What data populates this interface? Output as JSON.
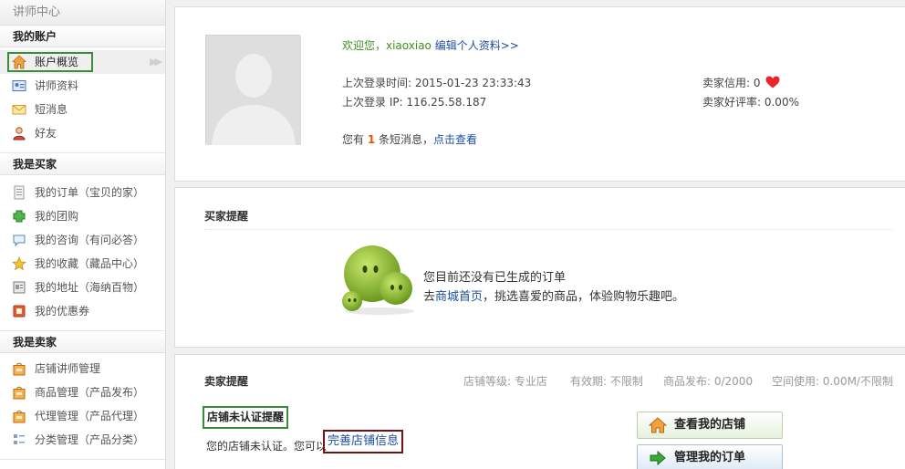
{
  "sidebar": {
    "title": "讲师中心",
    "sections": [
      {
        "title": "我的账户",
        "items": [
          {
            "label": "账户概览",
            "icon": "home-icon",
            "active": true
          },
          {
            "label": "讲师资料",
            "icon": "profile-card-icon"
          },
          {
            "label": "短消息",
            "icon": "envelope-icon"
          },
          {
            "label": "好友",
            "icon": "friend-icon"
          }
        ]
      },
      {
        "title": "我是买家",
        "items": [
          {
            "label": "我的订单（宝贝的家）",
            "icon": "order-icon"
          },
          {
            "label": "我的团购",
            "icon": "puzzle-icon"
          },
          {
            "label": "我的咨询（有问必答）",
            "icon": "speech-bubble-icon"
          },
          {
            "label": "我的收藏（藏品中心）",
            "icon": "star-icon"
          },
          {
            "label": "我的地址（海纳百物）",
            "icon": "address-book-icon"
          },
          {
            "label": "我的优惠券",
            "icon": "coupon-icon"
          }
        ]
      },
      {
        "title": "我是卖家",
        "items": [
          {
            "label": "店铺讲师管理",
            "icon": "shop-bag-icon"
          },
          {
            "label": "商品管理（产品发布）",
            "icon": "shop-bag-icon"
          },
          {
            "label": "代理管理（产品代理）",
            "icon": "shop-bag-icon"
          },
          {
            "label": "分类管理（产品分类）",
            "icon": "category-icon"
          }
        ]
      }
    ],
    "arrow": "▶▶"
  },
  "profile": {
    "welcome": "欢迎您，xiaoxiao",
    "edit_link": "编辑个人资料>>",
    "last_login_time_label": "上次登录时间: 2015-01-23 23:33:43",
    "last_login_ip_label": "上次登录 IP: 116.25.58.187",
    "seller_credit_label": "卖家信用: 0",
    "seller_rating_label": "卖家好评率: 0.00%",
    "msg_prefix": "您有",
    "msg_count": "1",
    "msg_suffix": "条短消息，",
    "msg_link": "点击查看"
  },
  "buyer_reminder": {
    "title": "买家提醒",
    "empty_line1": "您目前还没有已生成的订单",
    "empty_line2_prefix": "去",
    "empty_line2_link": "商城首页",
    "empty_line2_suffix": "，挑选喜爱的商品，体验购物乐趣吧。"
  },
  "seller_reminder": {
    "title": "卖家提醒",
    "shop_level": "店铺等级: 专业店",
    "validity": "有效期: 不限制",
    "products_published": "商品发布: 0/2000",
    "space_used": "空间使用: 0.00M/不限制",
    "cert_title": "店铺未认证提醒",
    "cert_msg": "您的店铺未认证。您可以",
    "cert_link": "完善店铺信息",
    "btn_view_shop": "查看我的店铺",
    "btn_manage_orders": "管理我的订单"
  },
  "colors": {
    "green_accent": "#3c8a3c",
    "link_blue": "#1c4fa0",
    "welcome_green": "#3f8f1e",
    "highlight_dark_red": "#6b1414"
  }
}
